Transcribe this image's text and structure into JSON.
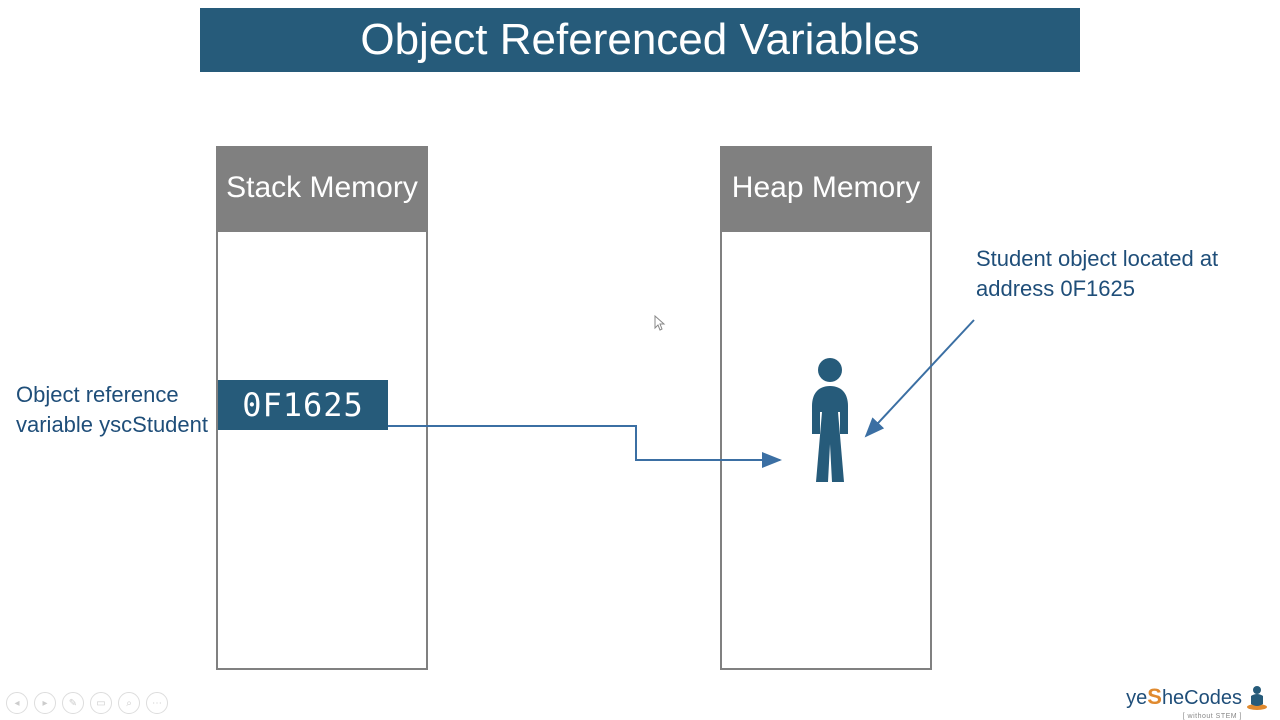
{
  "title": "Object Referenced Variables",
  "stack": {
    "header": "Stack Memory",
    "address": "0F1625"
  },
  "heap": {
    "header": "Heap Memory"
  },
  "labels": {
    "left": "Object reference variable yscStudent",
    "right": "Student object located at address 0F1625"
  },
  "logo": {
    "prefix": "ye",
    "accent": "S",
    "suffix": "heCodes",
    "sub": "[ without STEM ]"
  },
  "colors": {
    "brand": "#265b7a",
    "header_gray": "#808080",
    "text_blue": "#1f4e79",
    "accent_orange": "#e08a2f"
  }
}
